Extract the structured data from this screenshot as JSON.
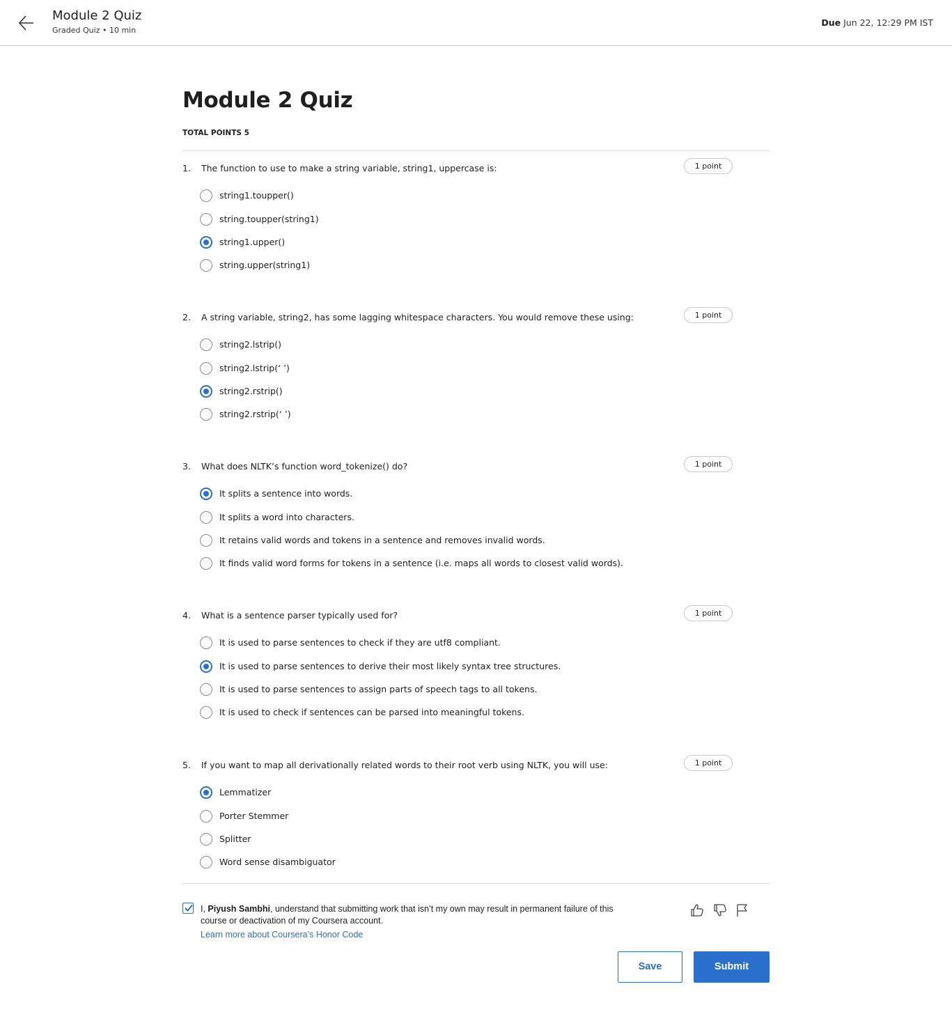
{
  "header": {
    "title": "Module 2 Quiz",
    "subtitle": "Graded Quiz • 10 min",
    "due_label": "Due",
    "due_value": "Jun 22, 12:29 PM IST"
  },
  "main": {
    "title": "Module 2 Quiz",
    "total_points": "TOTAL POINTS 5"
  },
  "questions": [
    {
      "number": "1.",
      "text": "The function to use to make a string variable, string1, uppercase is:",
      "points": "1 point",
      "options": [
        "string1.toupper()",
        "string.toupper(string1)",
        "string1.upper()",
        "string.upper(string1)"
      ],
      "selected": 2
    },
    {
      "number": "2.",
      "text": "A string variable, string2, has some lagging whitespace characters. You would remove these using:",
      "points": "1 point",
      "options": [
        "string2.lstrip()",
        "string2.lstrip(‘ ’)",
        "string2.rstrip()",
        "string2.rstrip(‘ ’)"
      ],
      "selected": 2
    },
    {
      "number": "3.",
      "text": "What does NLTK’s function word_tokenize() do?",
      "points": "1 point",
      "options": [
        "It splits a sentence into words.",
        "It splits a word into characters.",
        "It retains valid words and tokens in a sentence and removes invalid words.",
        "It finds valid word forms for tokens in a sentence (i.e. maps all words to closest valid words)."
      ],
      "selected": 0
    },
    {
      "number": "4.",
      "text": "What is a sentence parser typically used for?",
      "points": "1 point",
      "options": [
        "It is used to parse sentences to check if they are utf8 compliant.",
        "It is used to parse sentences to derive their most likely syntax tree structures.",
        "It is used to parse sentences to assign parts of speech tags to all tokens.",
        "It is used to check if sentences can be parsed into meaningful tokens."
      ],
      "selected": 1
    },
    {
      "number": "5.",
      "text": "If you want to map all derivationally related words to their root verb using NLTK, you will use:",
      "points": "1 point",
      "options": [
        "Lemmatizer",
        "Porter Stemmer",
        "Splitter",
        "Word sense disambiguator"
      ],
      "selected": 0
    }
  ],
  "honor": {
    "checked": true,
    "prefix": "I, ",
    "name": "Piyush Sambhi",
    "suffix": ", understand that submitting work that isn’t my own may result in permanent failure of this course or deactivation of my Coursera account.",
    "link": "Learn more about Coursera’s Honor Code"
  },
  "feedback_icons": [
    "thumbs-up-icon",
    "thumbs-down-icon",
    "flag-icon"
  ],
  "buttons": {
    "save": "Save",
    "submit": "Submit"
  },
  "colors": {
    "accent": "#2a6fcc",
    "text": "#1f1f1f",
    "divider": "#dcdcdc"
  }
}
